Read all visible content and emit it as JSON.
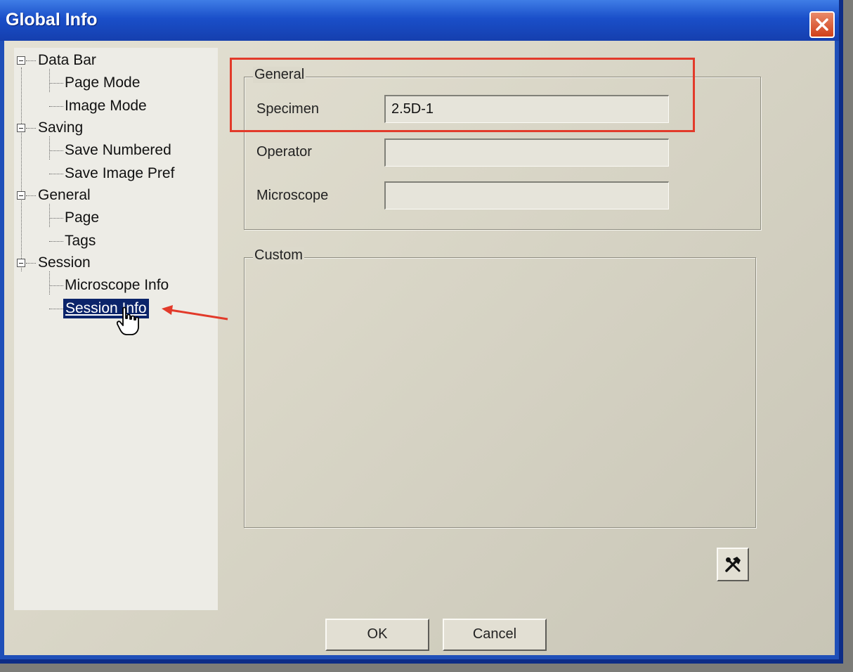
{
  "window": {
    "title": "Global Info"
  },
  "tree": {
    "items": [
      {
        "label": "Data Bar",
        "children": [
          {
            "label": "Page Mode"
          },
          {
            "label": "Image Mode"
          }
        ]
      },
      {
        "label": "Saving",
        "children": [
          {
            "label": "Save Numbered"
          },
          {
            "label": "Save Image Pref"
          }
        ]
      },
      {
        "label": "General",
        "children": [
          {
            "label": "Page"
          },
          {
            "label": "Tags"
          }
        ]
      },
      {
        "label": "Session",
        "children": [
          {
            "label": "Microscope Info"
          },
          {
            "label": "Session Info",
            "selected": true
          }
        ]
      }
    ]
  },
  "general_group": {
    "legend": "General",
    "fields": [
      {
        "label": "Specimen",
        "value": "2.5D-1"
      },
      {
        "label": "Operator",
        "value": ""
      },
      {
        "label": "Microscope",
        "value": ""
      }
    ]
  },
  "custom_group": {
    "legend": "Custom"
  },
  "tools_icon": "hammer-wrench-icon",
  "buttons": {
    "ok": "OK",
    "cancel": "Cancel"
  },
  "colors": {
    "titlebar": "#1a4fc9",
    "selection": "#0b246a",
    "annotation": "#e23a2a"
  }
}
